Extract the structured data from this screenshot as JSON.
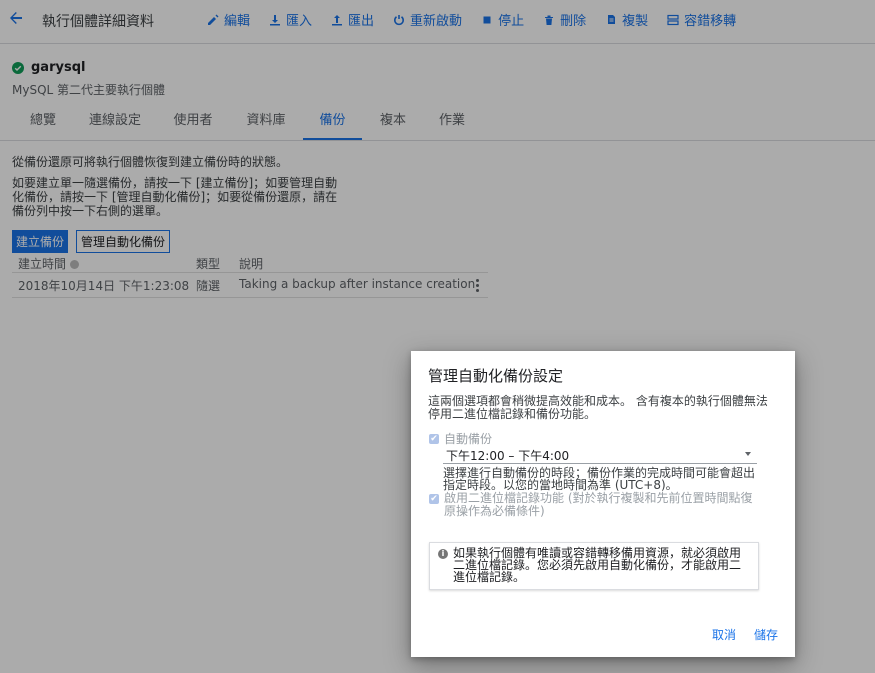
{
  "header": {
    "title": "執行個體詳細資料",
    "actions": [
      {
        "label": "編輯",
        "icon": "pencil-icon"
      },
      {
        "label": "匯入",
        "icon": "import-icon"
      },
      {
        "label": "匯出",
        "icon": "export-icon"
      },
      {
        "label": "重新啟動",
        "icon": "restart-icon"
      },
      {
        "label": "停止",
        "icon": "stop-icon"
      },
      {
        "label": "刪除",
        "icon": "trash-icon"
      },
      {
        "label": "複製",
        "icon": "copy-icon"
      },
      {
        "label": "容錯移轉",
        "icon": "failover-icon"
      }
    ]
  },
  "instance": {
    "name": "garysql",
    "subtitle": "MySQL 第二代主要執行個體",
    "status_color": "#0f9d58"
  },
  "tabs": [
    {
      "label": "總覽"
    },
    {
      "label": "連線設定"
    },
    {
      "label": "使用者"
    },
    {
      "label": "資料庫"
    },
    {
      "label": "備份",
      "active": true
    },
    {
      "label": "複本"
    },
    {
      "label": "作業"
    }
  ],
  "backup": {
    "intro": "從備份還原可將執行個體恢復到建立備份時的狀態。",
    "instructions": "如要建立單一隨選備份，請按一下 [建立備份]；如要管理自動化備份，請按一下 [管理自動化備份]；如要從備份還原，請在備份列中按一下右側的選單。",
    "create_button": "建立備份",
    "manage_button": "管理自動化備份",
    "table": {
      "headers": [
        "建立時間",
        "類型",
        "說明"
      ],
      "rows": [
        [
          "2018年10月14日 下午1:23:08",
          "隨選",
          "Taking a backup after instance creation"
        ]
      ]
    }
  },
  "dialog": {
    "title": "管理自動化備份設定",
    "intro": "這兩個選項都會稍微提高效能和成本。 含有複本的執行個體無法停用二進位檔記錄和備份功能。",
    "auto_backup_label": "自動備份",
    "window_value": "下午12:00 – 下午4:00",
    "window_hint": "選擇進行自動備份的時段；備份作業的完成時間可能會超出指定時段。以您的當地時間為準 (UTC+8)。",
    "binlog_label": "啟用二進位檔記錄功能 (對於執行複製和先前位置時間點復原操作為必備條件)",
    "info_text": "如果執行個體有唯讀或容錯轉移備用資源，就必須啟用二進位檔記錄。您必須先啟用自動化備份，才能啟用二進位檔記錄。",
    "cancel_label": "取消",
    "save_label": "儲存",
    "accent_color": "#1a73e8"
  }
}
